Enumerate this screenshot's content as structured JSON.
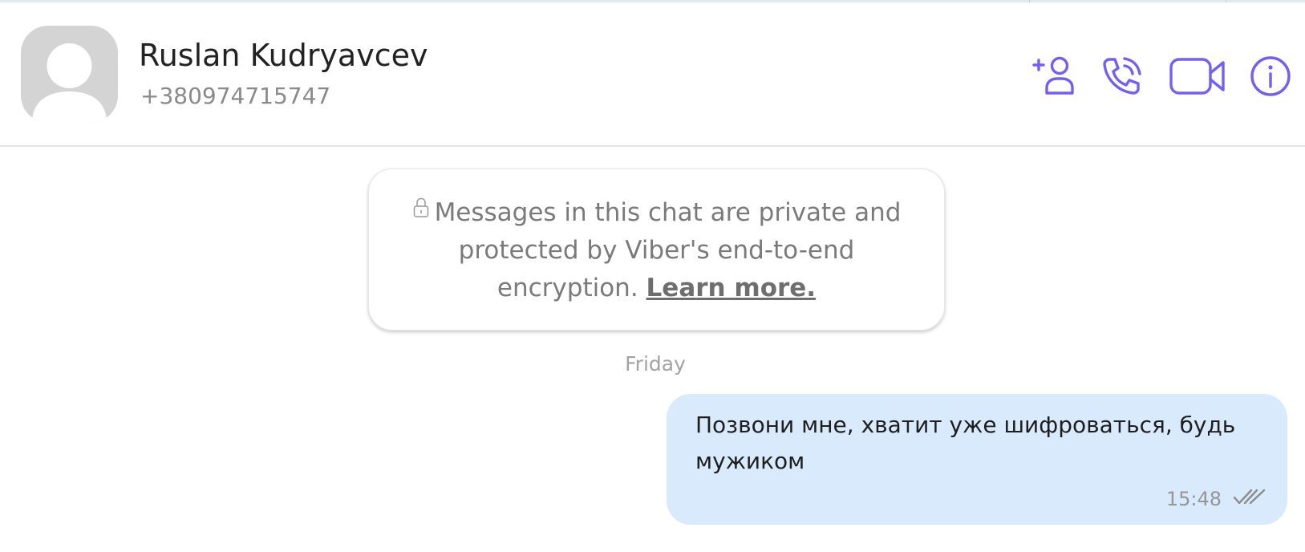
{
  "contact": {
    "name": "Ruslan Kudryavcev",
    "phone": "+380974715747",
    "avatar": "default-avatar-silhouette"
  },
  "header_actions": [
    {
      "name": "add-participant",
      "icon": "add-person-icon"
    },
    {
      "name": "voice-call",
      "icon": "phone-icon"
    },
    {
      "name": "video-call",
      "icon": "video-camera-icon"
    },
    {
      "name": "info",
      "icon": "info-icon"
    }
  ],
  "encryption_notice": {
    "icon": "lock-icon",
    "text": "Messages in this chat are private and protected by Viber's end-to-end encryption.",
    "link_label": "Learn more."
  },
  "day_separator": "Friday",
  "messages": [
    {
      "direction": "outgoing",
      "text": "Позвони мне, хватит уже шифроваться, будь мужиком",
      "time": "15:48",
      "status_icon": "double-check-icon"
    }
  ],
  "colors": {
    "accent": "#7360f2",
    "outgoing_bubble": "#d9eafd",
    "avatar_bg": "#d4d4d4",
    "secondary_text": "#8a8a8a"
  }
}
